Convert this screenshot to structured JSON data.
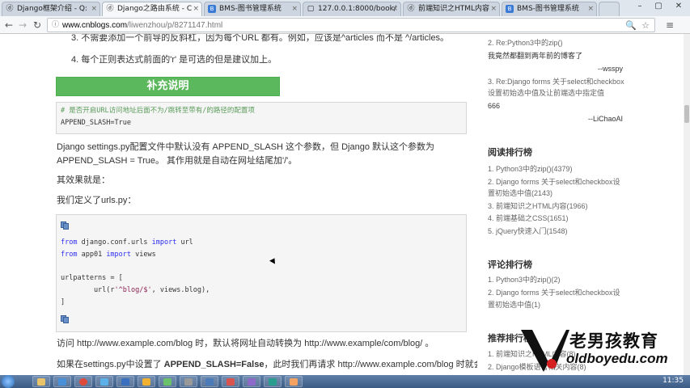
{
  "browser": {
    "tabs": [
      {
        "label": "Django框架介绍 - Q:",
        "icon": "logo-icon"
      },
      {
        "label": "Django之路由系统 - C",
        "icon": "logo-icon",
        "active": true
      },
      {
        "label": "BMS-图书管理系统",
        "icon": "bms-icon"
      },
      {
        "label": "127.0.0.1:8000/book/",
        "icon": "page-icon"
      },
      {
        "label": "前端知识之HTML内容",
        "icon": "logo-icon"
      },
      {
        "label": "BMS-图书管理系统",
        "icon": "bms-icon"
      }
    ],
    "url_host": "www.cnblogs.com",
    "url_path": "/liwenzhou/p/8271147.html"
  },
  "article": {
    "line_top": "3. 不需要添加一个前导的反斜杠，因为每个URL 都有。例如，应该是^articles 而不是 ^/articles。",
    "item4": "4. 每个正则表达式前面的'r' 是可选的但是建议加上。",
    "supplement_heading": "补充说明",
    "code1_comment": "# 是否开启URL访问地址后面不为/跳转至带有/的路径的配置项",
    "code1_line": "APPEND_SLASH=True",
    "para1_line1": "Django settings.py配置文件中默认没有 APPEND_SLASH 这个参数，但 Django 默认这个参数为",
    "para1_line2": "APPEND_SLASH = True。 其作用就是自动在网址结尾加'/'。",
    "para2": "其效果就是：",
    "para3": "我们定义了urls.py：",
    "code2": {
      "l1_kw1": "from",
      "l1_mod": " django.conf.urls ",
      "l1_kw2": "import",
      "l1_name": " url",
      "l2_kw1": "from",
      "l2_mod": " app01 ",
      "l2_kw2": "import",
      "l2_name": " views",
      "l3": "urlpatterns = [",
      "l4_pre": "        url(r",
      "l4_str": "'^blog/$'",
      "l4_post": ", views.blog),",
      "l5": "]"
    },
    "para4": "访问 http://www.example.com/blog 时，默认将网址自动转换为 http://www.example/com/blog/ 。",
    "para5_pre": "如果在settings.py中设置了 ",
    "para5_bold": "APPEND_SLASH=False",
    "para5_post": "，此时我们再请求 http://www.example.com/blog 时就会提"
  },
  "sidebar": {
    "recent_comments": [
      {
        "title": "2. Re:Python3中的zip()",
        "body": "我竟然都翻到两年前的博客了",
        "author": "--wsspy"
      },
      {
        "title": "3. Re:Django forms 关于select和checkbox",
        "title2": "设置初始选中值及让前端选中指定值",
        "body": "666",
        "author": "--LiChaoAI"
      }
    ],
    "read_rank_heading": "阅读排行榜",
    "read_rank": [
      "1. Python3中的zip()(4379)",
      "2. Django forms 关于select和checkbox设",
      "置初始选中值(2143)",
      "3. 前端知识之HTML内容(1966)",
      "4. 前端基础之CSS(1651)",
      "5. jQuery快速入门(1548)"
    ],
    "comment_rank_heading": "评论排行榜",
    "comment_rank": [
      "1. Python3中的zip()(2)",
      "2. Django forms 关于select和checkbox设",
      "置初始选中值(1)"
    ],
    "recommend_rank_heading": "推荐排行榜",
    "recommend_rank": [
      "1. 前端知识之HTML内容(8)",
      "2. Django模板语言相关内容(8)"
    ]
  },
  "watermark": {
    "cn": "老男孩教育",
    "en": "oldboyedu.com"
  },
  "taskbar": {
    "clock": "11:35"
  }
}
